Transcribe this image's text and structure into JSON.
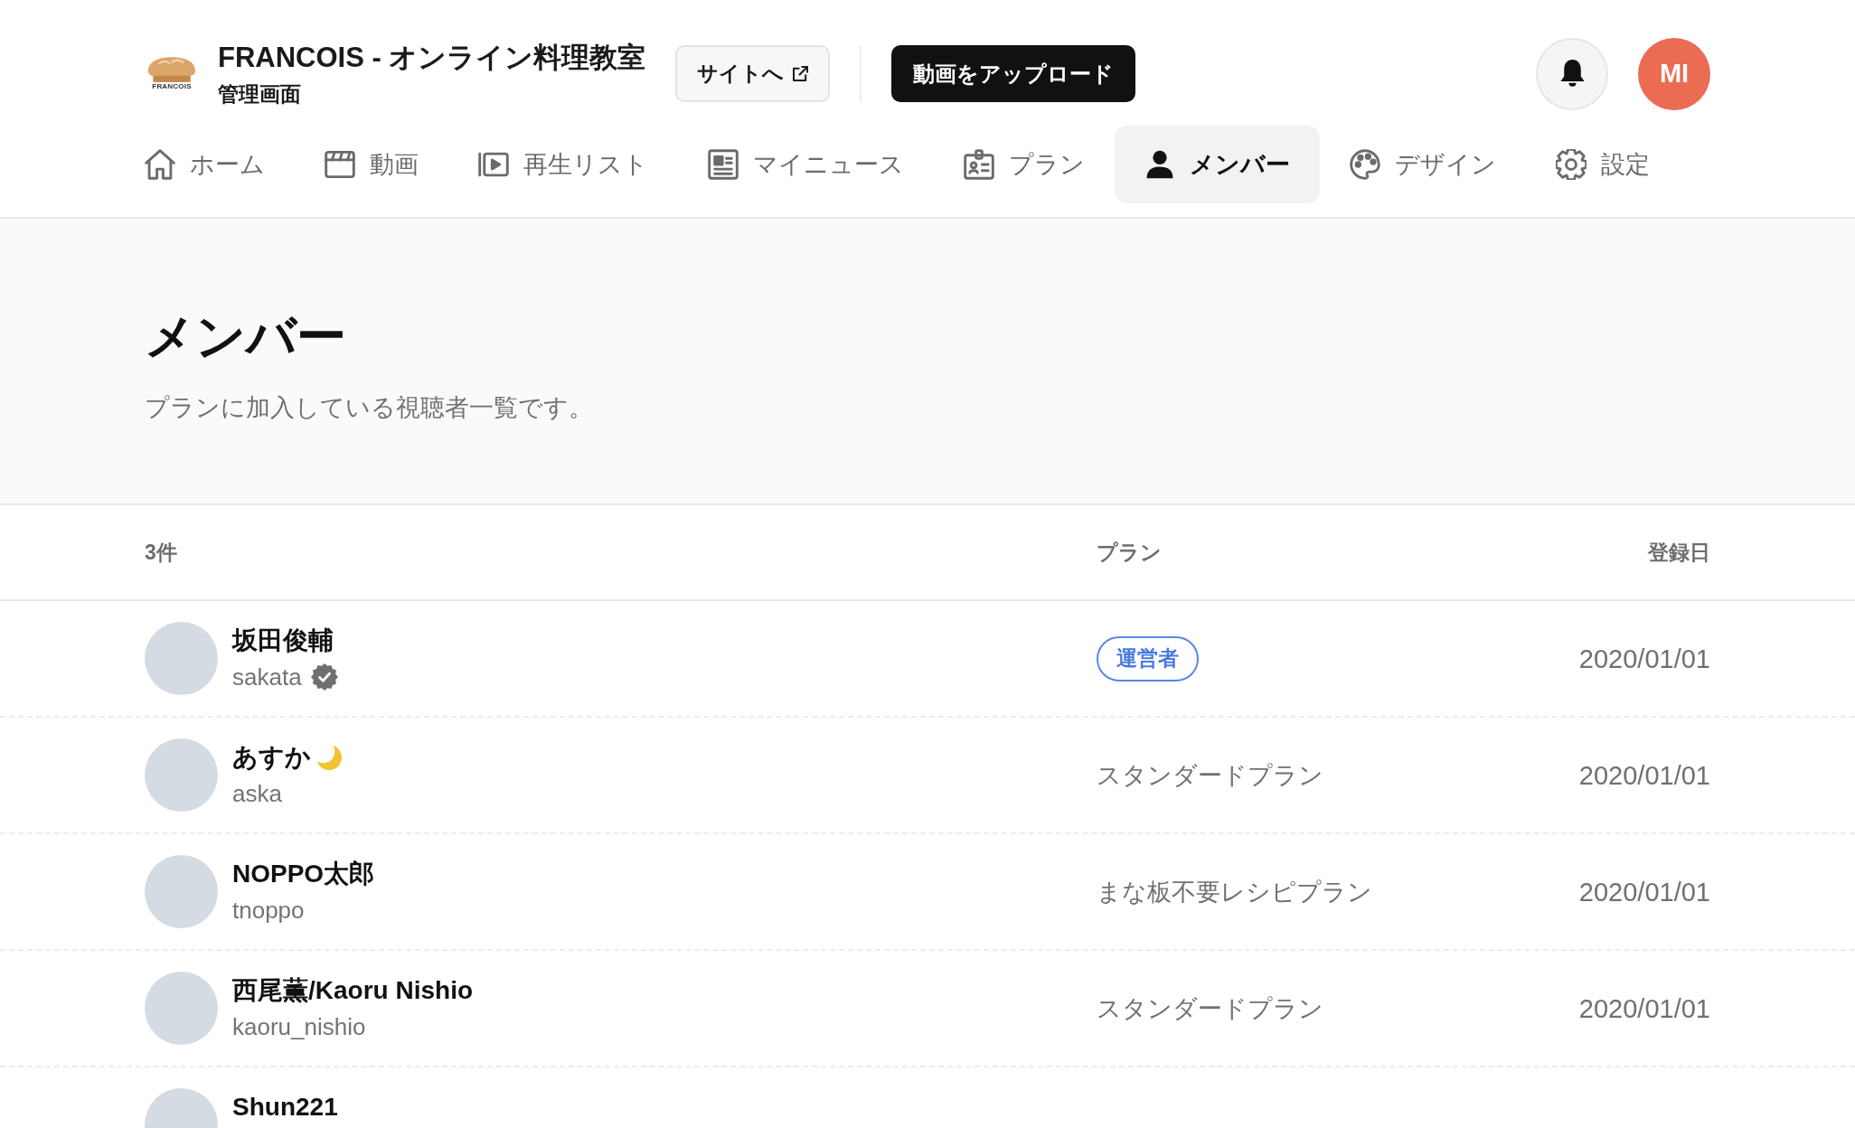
{
  "header": {
    "logo": {
      "text": "FRANCOIS"
    },
    "title": "FRANCOIS - オンライン料理教室",
    "subtitle": "管理画面",
    "site_button": "サイトへ",
    "upload_button": "動画をアップロード",
    "user_initials": "MI"
  },
  "nav": [
    {
      "label": "ホーム",
      "selected": false
    },
    {
      "label": "動画",
      "selected": false
    },
    {
      "label": "再生リスト",
      "selected": false
    },
    {
      "label": "マイニュース",
      "selected": false
    },
    {
      "label": "プラン",
      "selected": false
    },
    {
      "label": "メンバー",
      "selected": true
    },
    {
      "label": "デザイン",
      "selected": false
    },
    {
      "label": "設定",
      "selected": false
    }
  ],
  "page": {
    "title": "メンバー",
    "description": "プランに加入している視聴者一覧です。"
  },
  "table": {
    "count": "3件",
    "columns": [
      "プラン",
      "登録日"
    ],
    "rows": [
      {
        "name": "坂田俊輔",
        "username": "sakata",
        "verified": true,
        "emoji": false,
        "plan": {
          "label": "運営者",
          "kind": "badge"
        },
        "date": "2020/01/01"
      },
      {
        "name": "あすか",
        "username": "aska",
        "verified": false,
        "emoji": true,
        "plan": {
          "label": "スタンダードプラン",
          "kind": "text"
        },
        "date": "2020/01/01"
      },
      {
        "name": "NOPPO太郎",
        "username": "tnoppo",
        "verified": false,
        "emoji": false,
        "plan": {
          "label": "まな板不要レシピプラン",
          "kind": "text"
        },
        "date": "2020/01/01"
      },
      {
        "name": "西尾薫/Kaoru Nishio",
        "username": "kaoru_nishio",
        "verified": false,
        "emoji": false,
        "plan": {
          "label": "スタンダードプラン",
          "kind": "text"
        },
        "date": "2020/01/01"
      },
      {
        "name": "Shun221",
        "verified": false,
        "emoji": false
      }
    ]
  }
}
